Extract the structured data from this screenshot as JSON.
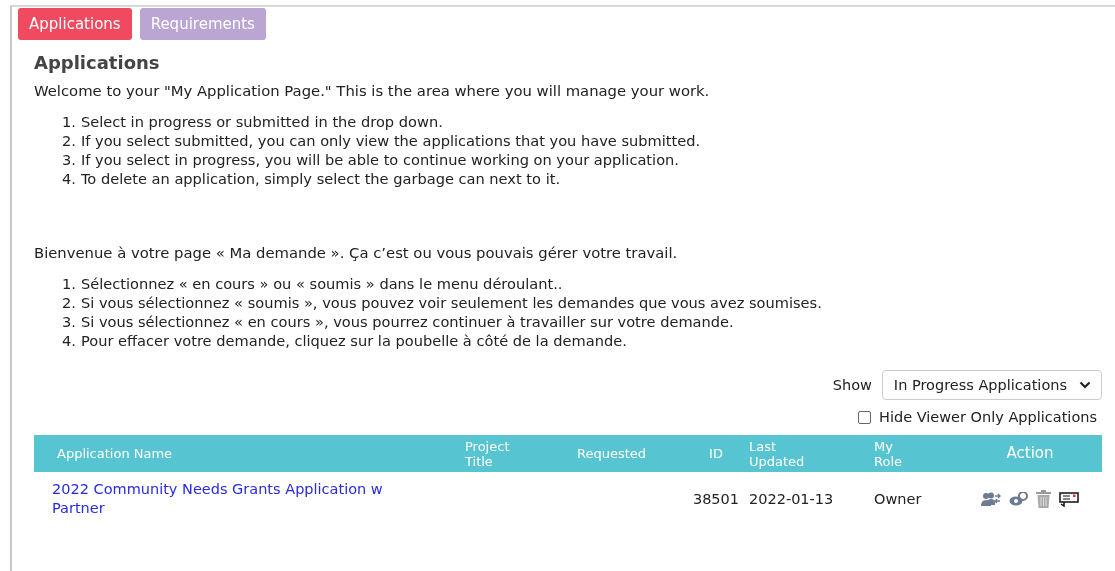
{
  "tabs": [
    {
      "label": "Applications",
      "selected": true
    },
    {
      "label": "Requirements",
      "selected": false
    }
  ],
  "heading": "Applications",
  "intro_en": "Welcome to your \"My Application Page.\" This is the area where you will manage your work.",
  "steps_en": [
    {
      "number": "1.",
      "text": "Select in progress or submitted in the drop down."
    },
    {
      "number": "2.",
      "text": "If you select submitted, you can only view the applications that you have submitted."
    },
    {
      "number": "3.",
      "text": "If you select in progress, you will be able to continue working on your application."
    },
    {
      "number": "4.",
      "text": "To delete an application, simply select the garbage can next to it."
    }
  ],
  "intro_fr": "Bienvenue à votre page « Ma demande ». Ça c’est ou vous pouvais gérer votre travail.",
  "steps_fr": [
    {
      "number": "1.",
      "text": "Sélectionnez « en cours » ou « soumis » dans le menu déroulant.."
    },
    {
      "number": "2.",
      "text": "Si vous sélectionnez « soumis », vous pouvez voir seulement les demandes que vous avez soumises."
    },
    {
      "number": "3.",
      "text": "Si vous sélectionnez « en cours », vous pourrez continuer à travailler sur votre demande."
    },
    {
      "number": "4.",
      "text": "Pour effacer votre demande, cliquez sur la poubelle à côté de la demande."
    }
  ],
  "filter": {
    "label": "Show",
    "value": "In Progress Applications"
  },
  "hide_viewer": {
    "label": "Hide Viewer Only Applications",
    "checked": false
  },
  "table": {
    "columns": [
      {
        "label": "Application Name"
      },
      {
        "label": "Project Title"
      },
      {
        "label": "Requested"
      },
      {
        "label": "ID"
      },
      {
        "label": "Last Updated"
      },
      {
        "label": "My Role"
      },
      {
        "label": "Action"
      }
    ],
    "rows": [
      {
        "name": "2022 Community Needs Grants Application w Partner",
        "id": "38501",
        "last_updated": "2022-01-13",
        "role": "Owner",
        "actions": [
          {
            "kind": "people"
          },
          {
            "kind": "link"
          },
          {
            "kind": "trash"
          },
          {
            "kind": "message"
          }
        ]
      }
    ]
  }
}
